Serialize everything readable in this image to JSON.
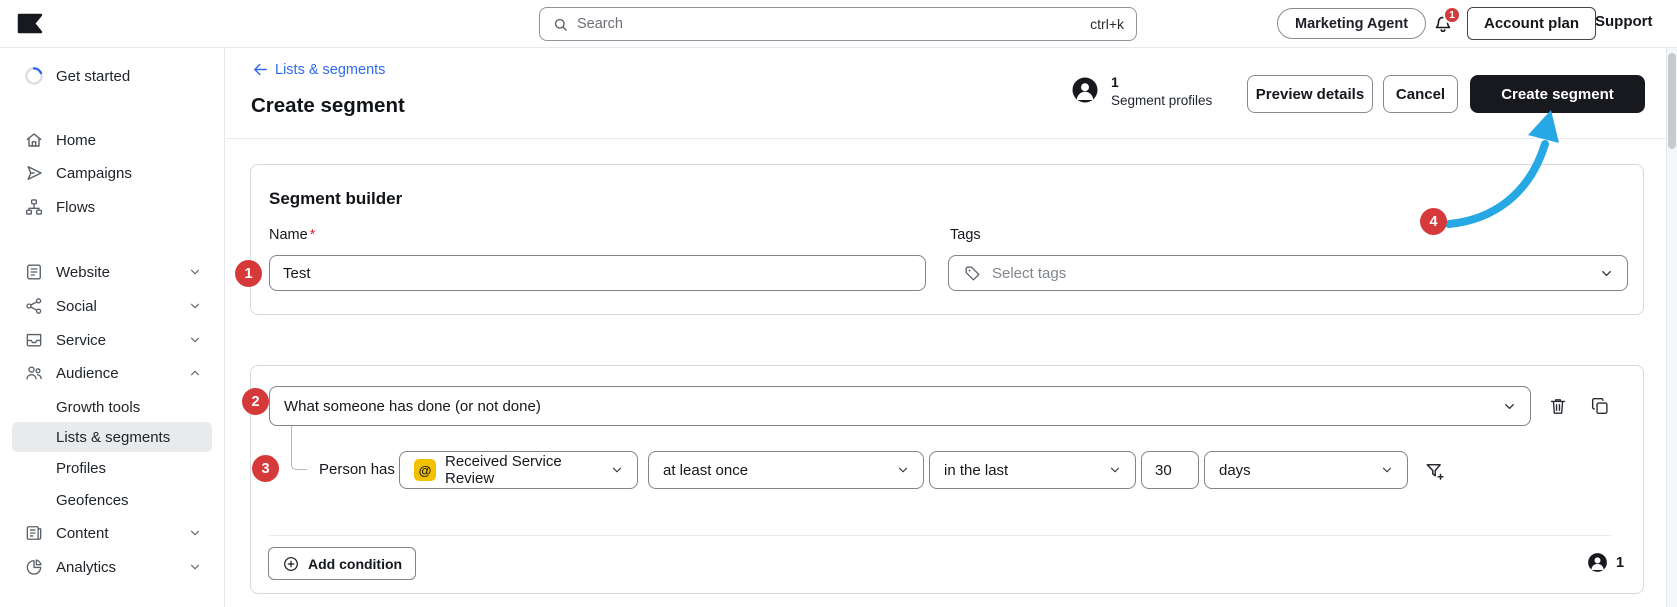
{
  "topbar": {
    "search_placeholder": "Search",
    "search_shortcut": "ctrl+k",
    "marketing_agent": "Marketing Agent",
    "notification_count": "1",
    "account_plan": "Account plan",
    "support": "Support"
  },
  "sidebar": {
    "items": [
      {
        "label": "Get started"
      },
      {
        "label": "Home"
      },
      {
        "label": "Campaigns"
      },
      {
        "label": "Flows"
      },
      {
        "label": "Website"
      },
      {
        "label": "Social"
      },
      {
        "label": "Service"
      },
      {
        "label": "Audience"
      },
      {
        "label": "Growth tools"
      },
      {
        "label": "Lists & segments"
      },
      {
        "label": "Profiles"
      },
      {
        "label": "Geofences"
      },
      {
        "label": "Content"
      },
      {
        "label": "Analytics"
      }
    ]
  },
  "header": {
    "back_link": "Lists & segments",
    "title": "Create segment",
    "profile_count": "1",
    "profile_label": "Segment profiles",
    "preview_button": "Preview details",
    "cancel_button": "Cancel",
    "create_button": "Create segment"
  },
  "builder": {
    "title": "Segment builder",
    "name_label": "Name",
    "required_mark": "*",
    "name_value": "Test",
    "tags_label": "Tags",
    "tags_placeholder": "Select tags"
  },
  "condition": {
    "definition_value": "What someone has done (or not done)",
    "person_has": "Person has",
    "event_icon_glyph": "@",
    "event_value": "Received Service Review",
    "frequency_value": "at least once",
    "timeframe_value": "in the last",
    "amount_value": "30",
    "unit_value": "days",
    "add_condition": "Add condition",
    "profile_count": "1"
  },
  "annotations": {
    "step1": "1",
    "step2": "2",
    "step3": "3",
    "step4": "4"
  },
  "colors": {
    "annotation_red": "#d6393a",
    "arrow_blue": "#25a8e4",
    "link_blue": "#2e6af0",
    "event_yellow": "#f2c200",
    "primary_dark": "#17191e"
  }
}
